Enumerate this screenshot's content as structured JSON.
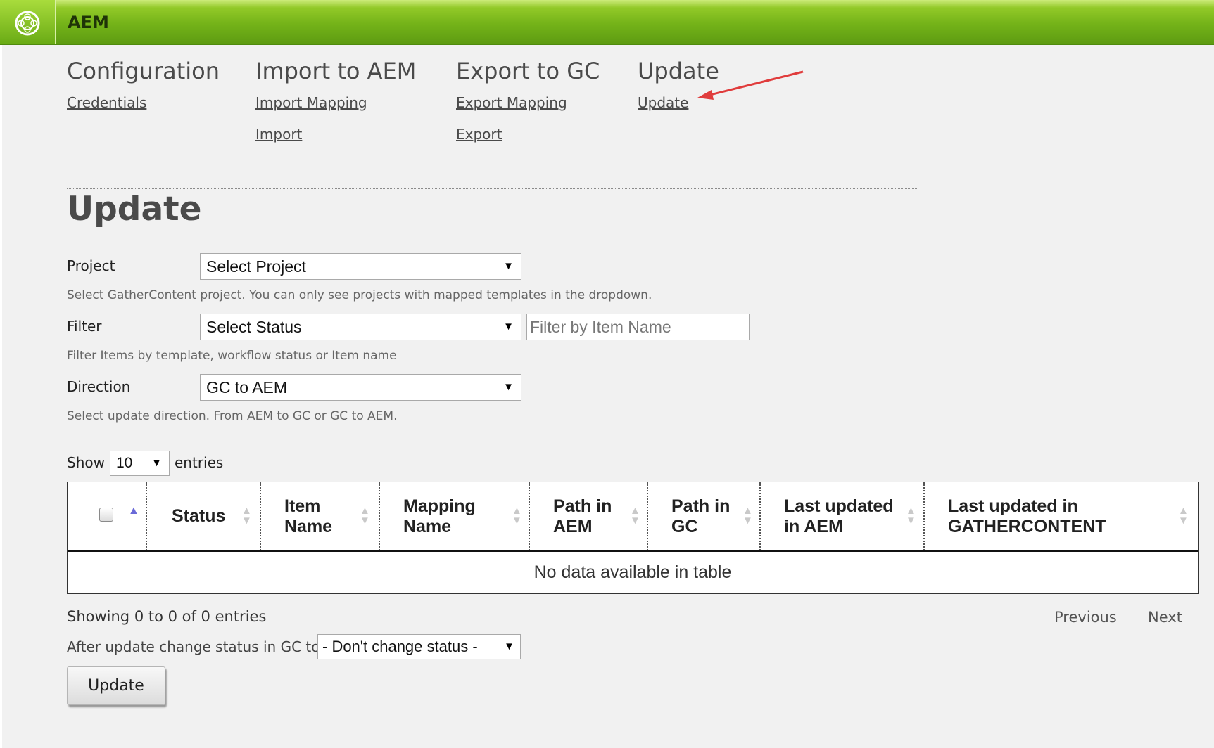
{
  "app": {
    "title": "AEM"
  },
  "nav": [
    {
      "heading": "Configuration",
      "links": [
        "Credentials"
      ]
    },
    {
      "heading": "Import to AEM",
      "links": [
        "Import Mapping",
        "Import"
      ]
    },
    {
      "heading": "Export to GC",
      "links": [
        "Export Mapping",
        "Export"
      ]
    },
    {
      "heading": "Update",
      "links": [
        "Update"
      ]
    }
  ],
  "page": {
    "title": "Update"
  },
  "form": {
    "project": {
      "label": "Project",
      "value": "Select Project",
      "help": "Select GatherContent project. You can only see projects with mapped templates in the dropdown."
    },
    "filter": {
      "label": "Filter",
      "value": "Select Status",
      "placeholder": "Filter by Item Name",
      "help": "Filter Items by template, workflow status or Item name"
    },
    "direction": {
      "label": "Direction",
      "value": "GC to AEM",
      "help": "Select update direction. From AEM to GC or GC to AEM."
    }
  },
  "table": {
    "show_label": "Show",
    "page_size": "10",
    "entries_label": "entries",
    "columns": [
      [
        "Status"
      ],
      [
        "Item",
        "Name"
      ],
      [
        "Mapping",
        "Name"
      ],
      [
        "Path in",
        "AEM"
      ],
      [
        "Path in",
        "GC"
      ],
      [
        "Last updated",
        "in AEM"
      ],
      [
        "Last updated in",
        "GATHERCONTENT"
      ]
    ],
    "empty_message": "No data available in table",
    "info": "Showing 0 to 0 of 0 entries",
    "previous": "Previous",
    "next": "Next"
  },
  "after_update": {
    "label": "After update change status in GC to",
    "value": "- Don't change status -"
  },
  "submit_label": "Update",
  "colors": {
    "header_green": "#74b319",
    "annotation_arrow": "#e03c3c"
  }
}
